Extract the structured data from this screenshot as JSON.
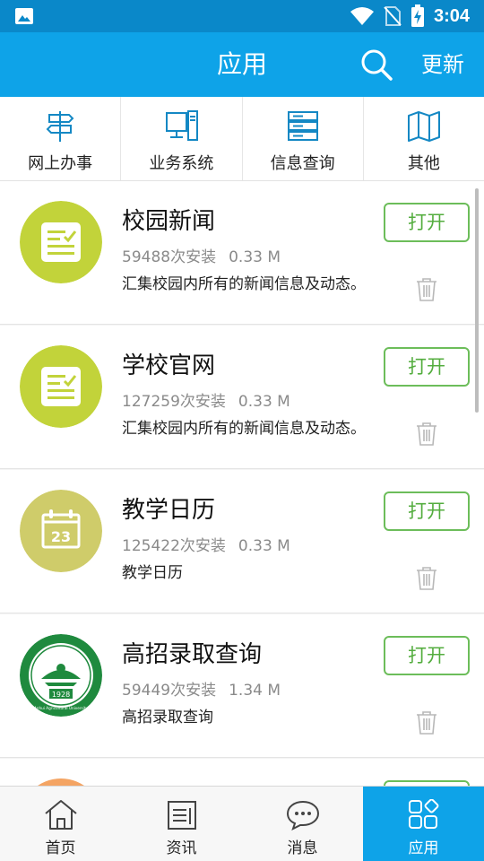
{
  "status_bar": {
    "time": "3:04"
  },
  "header": {
    "title": "应用",
    "update_label": "更新"
  },
  "categories": [
    {
      "label": "网上办事",
      "icon": "signpost-icon"
    },
    {
      "label": "业务系统",
      "icon": "computer-icon"
    },
    {
      "label": "信息查询",
      "icon": "server-icon"
    },
    {
      "label": "其他",
      "icon": "map-icon"
    }
  ],
  "apps": [
    {
      "name": "校园新闻",
      "installs": "59488次安装",
      "size": "0.33 M",
      "desc": "汇集校园内所有的新闻信息及动态。",
      "open_label": "打开",
      "icon": "news-document-icon",
      "icon_color": "#c2d33a"
    },
    {
      "name": "学校官网",
      "installs": "127259次安装",
      "size": "0.33 M",
      "desc": "汇集校园内所有的新闻信息及动态。",
      "open_label": "打开",
      "icon": "news-document-icon",
      "icon_color": "#c2d33a"
    },
    {
      "name": "教学日历",
      "installs": "125422次安装",
      "size": "0.33 M",
      "desc": "教学日历",
      "open_label": "打开",
      "icon": "calendar-icon",
      "icon_color": "#cfcc6a",
      "calendar_day": "23"
    },
    {
      "name": "高招录取查询",
      "installs": "59449次安装",
      "size": "1.34 M",
      "desc": "高招录取查询",
      "open_label": "打开",
      "icon": "university-seal-icon",
      "icon_color": "#1f8a3e",
      "seal_text": "Anhui Agricultural University",
      "seal_year": "1928"
    }
  ],
  "bottom_nav": [
    {
      "label": "首页",
      "icon": "home-icon"
    },
    {
      "label": "资讯",
      "icon": "news-icon"
    },
    {
      "label": "消息",
      "icon": "message-icon"
    },
    {
      "label": "应用",
      "icon": "apps-icon",
      "active": true
    }
  ],
  "colors": {
    "status_bar": "#0a88c9",
    "header": "#0ea3e8",
    "open_button": "#6cbd5a",
    "active_tab": "#0ea3e8"
  }
}
